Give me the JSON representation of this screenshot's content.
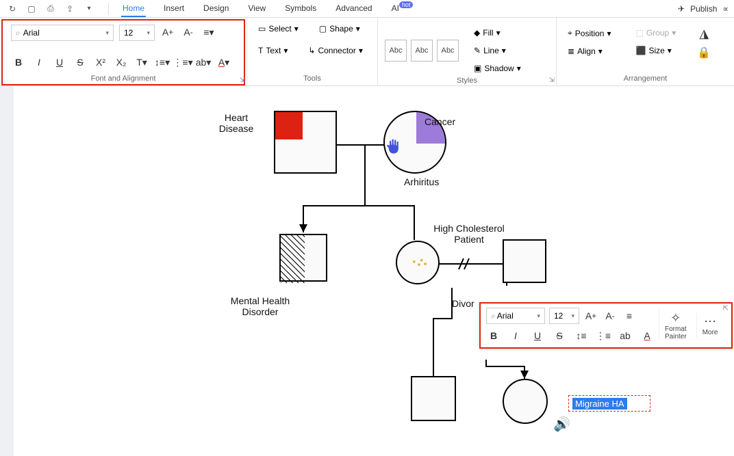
{
  "topbar": {
    "publish": "Publish"
  },
  "tabs": {
    "home": "Home",
    "insert": "Insert",
    "design": "Design",
    "view": "View",
    "symbols": "Symbols",
    "advanced": "Advanced",
    "ai": "AI",
    "hot": "hot"
  },
  "ribbon": {
    "font_name": "Arial",
    "font_size": "12",
    "group_font": "Font and Alignment",
    "select": "Select",
    "text": "Text",
    "shape": "Shape",
    "connector": "Connector",
    "group_tools": "Tools",
    "fill": "Fill",
    "line": "Line",
    "shadow": "Shadow",
    "group_styles": "Styles",
    "position": "Position",
    "align": "Align",
    "group": "Group",
    "size": "Size",
    "group_arrangement": "Arrangement",
    "abc": "Abc"
  },
  "canvas": {
    "heart_disease": "Heart\nDisease",
    "cancer": "Cancer",
    "arhiritus": "Arhiritus",
    "mental_health": "Mental Health\nDisorder",
    "high_chol": "High Cholesterol\nPatient",
    "divor": "Divor",
    "migraine": "Migraine HA"
  },
  "float": {
    "font_name": "Arial",
    "font_size": "12",
    "format": "Format",
    "painter": "Painter",
    "more": "More"
  }
}
